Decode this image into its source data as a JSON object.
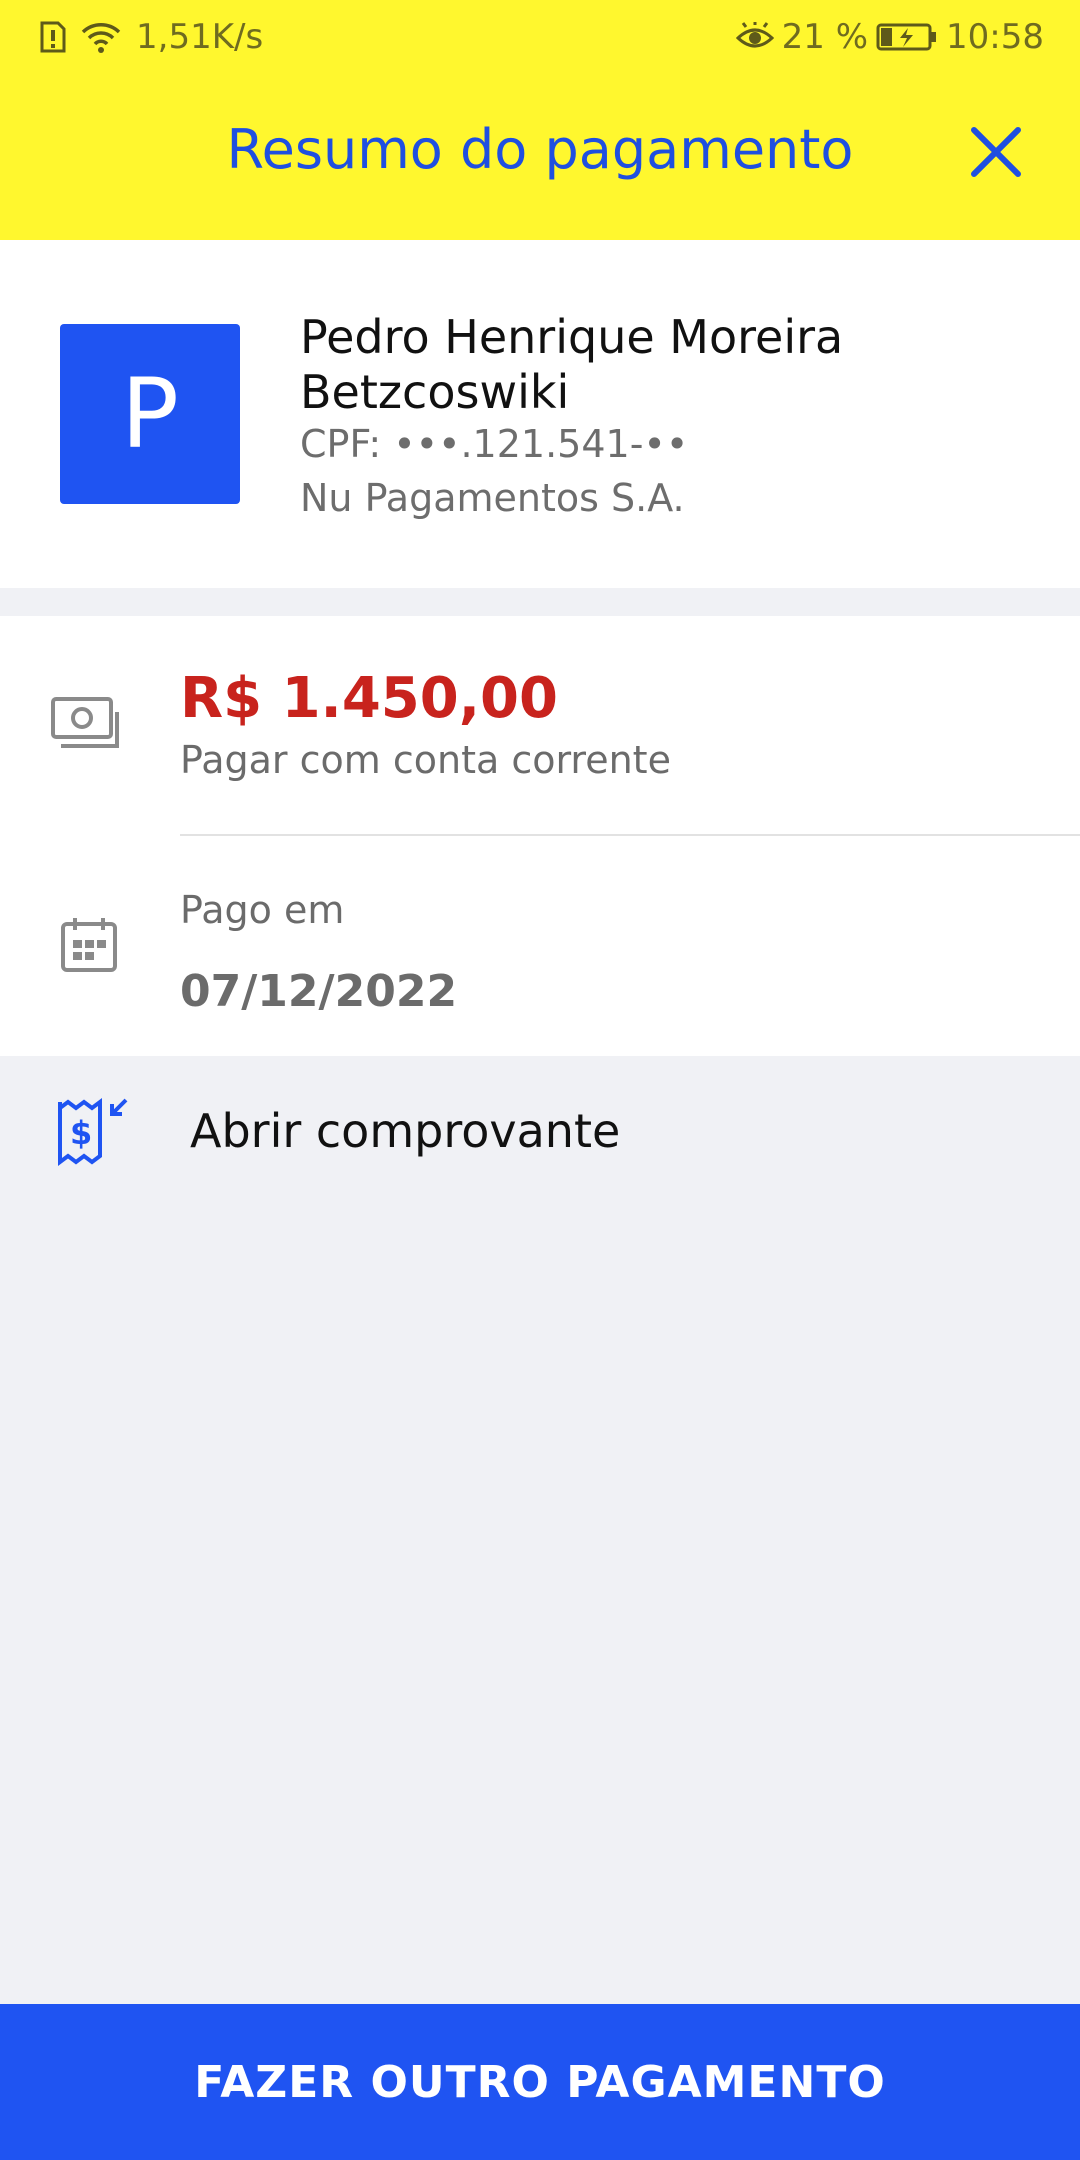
{
  "status_bar": {
    "net_speed": "1,51K/s",
    "battery": "21 %",
    "time": "10:58"
  },
  "header": {
    "title": "Resumo do pagamento"
  },
  "recipient": {
    "avatar_letter": "P",
    "name": "Pedro Henrique Moreira Betzcoswiki",
    "cpf": "CPF: •••.121.541-••",
    "bank": "Nu Pagamentos S.A."
  },
  "payment": {
    "amount": "R$ 1.450,00",
    "method": "Pagar com conta corrente",
    "date_label": "Pago em",
    "date": "07/12/2022"
  },
  "receipt": {
    "label": "Abrir comprovante"
  },
  "cta": {
    "label": "FAZER OUTRO PAGAMENTO"
  },
  "colors": {
    "header_bg": "#fff72e",
    "accent_blue": "#1f54f2",
    "amount_red": "#c8231d"
  }
}
